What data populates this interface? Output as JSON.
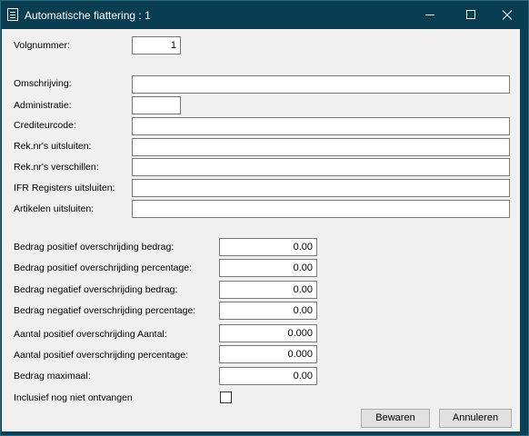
{
  "window": {
    "title": "Automatische fiattering : 1"
  },
  "icons": {
    "app": "app-form-icon",
    "minimize": "minimize-icon",
    "maximize": "maximize-icon",
    "close": "close-icon"
  },
  "form": {
    "volgnummer": {
      "label": "Volgnummer:",
      "value": "1"
    },
    "omschrijving": {
      "label": "Omschrijving:",
      "value": ""
    },
    "administratie": {
      "label": "Administratie:",
      "value": ""
    },
    "crediteurcode": {
      "label": "Crediteurcode:",
      "value": ""
    },
    "reknr_uitsluiten": {
      "label": "Rek.nr's uitsluiten:",
      "value": ""
    },
    "reknr_verschillen": {
      "label": "Rek.nr's verschillen:",
      "value": ""
    },
    "ifr_registers": {
      "label": "IFR Registers uitsluiten:",
      "value": ""
    },
    "artikelen": {
      "label": "Artikelen uitsluiten:",
      "value": ""
    },
    "bedrag_pos_bedrag": {
      "label": "Bedrag positief overschrijding bedrag:",
      "value": "0.00"
    },
    "bedrag_pos_perc": {
      "label": "Bedrag positief overschrijding percentage:",
      "value": "0.00"
    },
    "bedrag_neg_bedrag": {
      "label": "Bedrag negatief overschrijding bedrag:",
      "value": "0.00"
    },
    "bedrag_neg_perc": {
      "label": "Bedrag negatief overschrijding percentage:",
      "value": "0.00"
    },
    "aantal_pos_aantal": {
      "label": "Aantal positief overschrijding Aantal:",
      "value": "0.000"
    },
    "aantal_pos_perc": {
      "label": "Aantal positief overschrijding percentage:",
      "value": "0.000"
    },
    "bedrag_max": {
      "label": "Bedrag maximaal:",
      "value": "0.00"
    },
    "inclusief": {
      "label": "Inclusief nog niet ontvangen",
      "checked": false
    }
  },
  "buttons": {
    "save": "Bewaren",
    "cancel": "Annuleren"
  }
}
